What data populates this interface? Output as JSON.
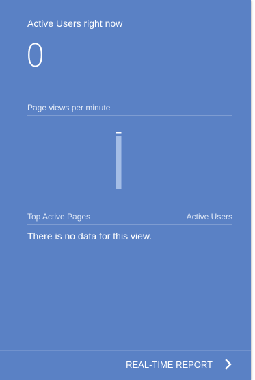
{
  "card": {
    "title": "Active Users right now",
    "active_users": "0",
    "chart_label": "Page views per minute",
    "table": {
      "col_pages": "Top Active Pages",
      "col_users": "Active Users",
      "empty_message": "There is no data for this view."
    },
    "footer_link": "REAL-TIME REPORT",
    "footer_icon": "chevron-right-icon"
  },
  "colors": {
    "card_bg": "#5a81c5",
    "bar": "#a4bde6",
    "bar_cap": "#ffffff",
    "baseline": "#a8bfe5"
  },
  "chart_data": {
    "type": "bar",
    "title": "Page views per minute",
    "values": [
      0,
      0,
      0,
      0,
      0,
      0,
      0,
      0,
      0,
      0,
      0,
      0,
      0,
      0,
      0,
      0,
      0,
      0,
      0,
      0,
      0,
      0,
      0,
      0,
      0,
      0,
      0,
      0,
      0,
      0
    ],
    "highlight_index": 13,
    "highlight_level": 0.85,
    "grid": false
  }
}
